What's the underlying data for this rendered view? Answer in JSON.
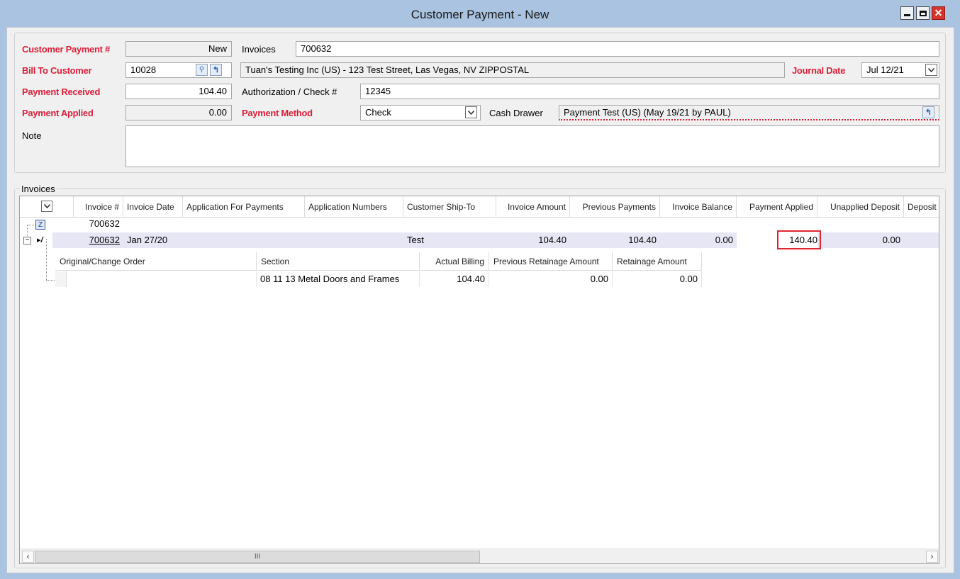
{
  "window": {
    "title": "Customer Payment - New",
    "controls": {
      "minimize": "minimize-icon",
      "maximize": "maximize-icon",
      "close": "close-icon"
    }
  },
  "header": {
    "customer_payment_label": "Customer Payment #",
    "customer_payment_value": "New",
    "invoices_label": "Invoices",
    "invoices_value": "700632",
    "bill_to_label": "Bill To Customer",
    "bill_to_value": "10028",
    "customer_desc": "Tuan's Testing Inc (US) - 123 Test Street, Las Vegas, NV  ZIPPOSTAL",
    "journal_date_label": "Journal Date",
    "journal_date_value": "Jul 12/21",
    "payment_received_label": "Payment Received",
    "payment_received_value": "104.40",
    "auth_label": "Authorization / Check #",
    "auth_value": "12345",
    "payment_applied_label": "Payment Applied",
    "payment_applied_value": "0.00",
    "payment_method_label": "Payment Method",
    "payment_method_value": "Check",
    "cash_drawer_label": "Cash Drawer",
    "cash_drawer_value": "Payment Test (US) (May 19/21 by PAUL)",
    "note_label": "Note",
    "note_value": ""
  },
  "grid": {
    "section_label": "Invoices",
    "columns": [
      "Invoice #",
      "Invoice Date",
      "Application For Payments",
      "Application Numbers",
      "Customer Ship-To",
      "Invoice Amount",
      "Previous Payments",
      "Invoice Balance",
      "Payment Applied",
      "Unapplied Deposit",
      "Deposit"
    ],
    "filter_row": {
      "invoice": "700632"
    },
    "row": {
      "invoice": "700632",
      "invoice_date": "Jan 27/20",
      "application_for_payments": "",
      "application_numbers": "",
      "ship_to": "Test",
      "invoice_amount": "104.40",
      "previous_payments": "104.40",
      "invoice_balance": "0.00",
      "payment_applied": "140.40",
      "unapplied_deposit": "0.00",
      "deposit": ""
    },
    "sub_columns": [
      "Original/Change Order",
      "Section",
      "Actual Billing",
      "Previous Retainage Amount",
      "Retainage Amount"
    ],
    "sub_row": {
      "order": "",
      "section": "08 11 13 Metal Doors and Frames",
      "actual_billing": "104.40",
      "previous_retainage": "0.00",
      "retainage": "0.00"
    },
    "scroll_thumb_glyph": "III"
  },
  "colors": {
    "required_label": "#d9213c",
    "highlight_row": "#e6e6f5",
    "edit_outline": "#e0262e",
    "window_frame": "#a9c3e0"
  }
}
